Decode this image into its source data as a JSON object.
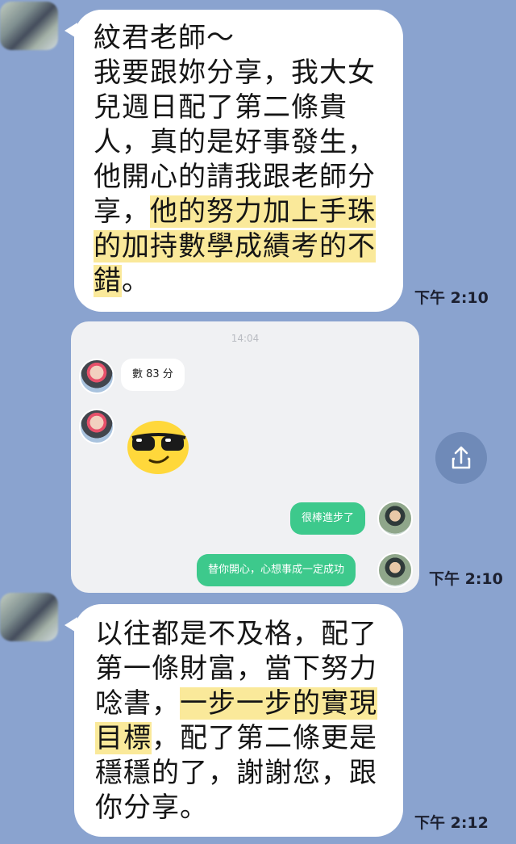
{
  "messages": {
    "first": {
      "line1": "紋君老師～",
      "line2": "我要跟妳分享，我大女",
      "line3": "兒週日配了第二條貴",
      "line4": "人，真的是好事發生，",
      "line5": "他開心的請我跟老師分",
      "line6_plain": "享，",
      "line6_hl": "他的努力加上手珠",
      "line7_hl": "的加持數學成績考的不",
      "line8_hl": "錯",
      "line8_plain": "。",
      "time": "下午 2:10"
    },
    "screenshot": {
      "time": "14:04",
      "score": "數 83 分",
      "emoji": "sunglasses-emoji",
      "reply1": "很棒進步了",
      "reply2": "替你開心，心想事成一定成功",
      "time_outer": "下午 2:10"
    },
    "second": {
      "line1": "以往都是不及格，配了",
      "line2": "第一條財富，當下努力",
      "line3_plain": "唸書，",
      "line3_hl": "一步一步的實現",
      "line4_hl": "目標",
      "line4_plain": "，配了第二條更是",
      "line5": "穩穩的了，謝謝您，跟",
      "line6": "你分享。",
      "time": "下午 2:12"
    }
  },
  "icons": {
    "share": "share-icon"
  },
  "colors": {
    "background": "#8aa3cf",
    "highlight": "#fae99a",
    "sent_bubble": "#3dc98c"
  }
}
